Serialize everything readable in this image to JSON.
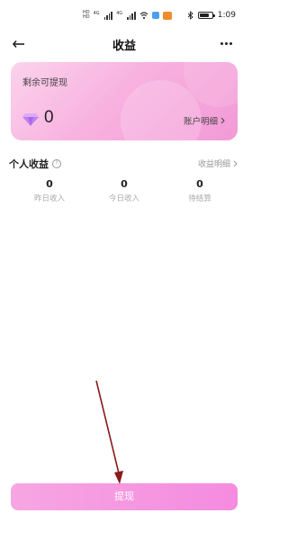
{
  "status_bar": {
    "hd1": "HD",
    "hd2": "HD",
    "signal_label_1": "4G",
    "signal_label_2": "4G",
    "time": "1:09",
    "battery_level": 0.8,
    "icons": [
      "hd-icon",
      "signal-icon",
      "wifi-icon",
      "app-notification-icon",
      "bluetooth-icon",
      "battery-icon"
    ]
  },
  "nav": {
    "title": "收益",
    "back_icon": "back-arrow-icon",
    "more_icon": "more-dots-icon"
  },
  "balance_card": {
    "label": "剩余可提现",
    "balance": "0",
    "gem_icon": "diamond-icon",
    "account_link": "账户明细",
    "gradient_colors": [
      "#fbd3ec",
      "#f29ad6"
    ]
  },
  "personal_income": {
    "title": "个人收益",
    "help_glyph": "?",
    "detail_link": "收益明细",
    "stats": [
      {
        "value": "0",
        "label": "昨日收入"
      },
      {
        "value": "0",
        "label": "今日收入"
      },
      {
        "value": "0",
        "label": "待结算"
      }
    ]
  },
  "withdraw_button": {
    "label": "提现",
    "color": "#f58be0"
  },
  "annotation": {
    "arrow_color": "#8b1a1a"
  }
}
